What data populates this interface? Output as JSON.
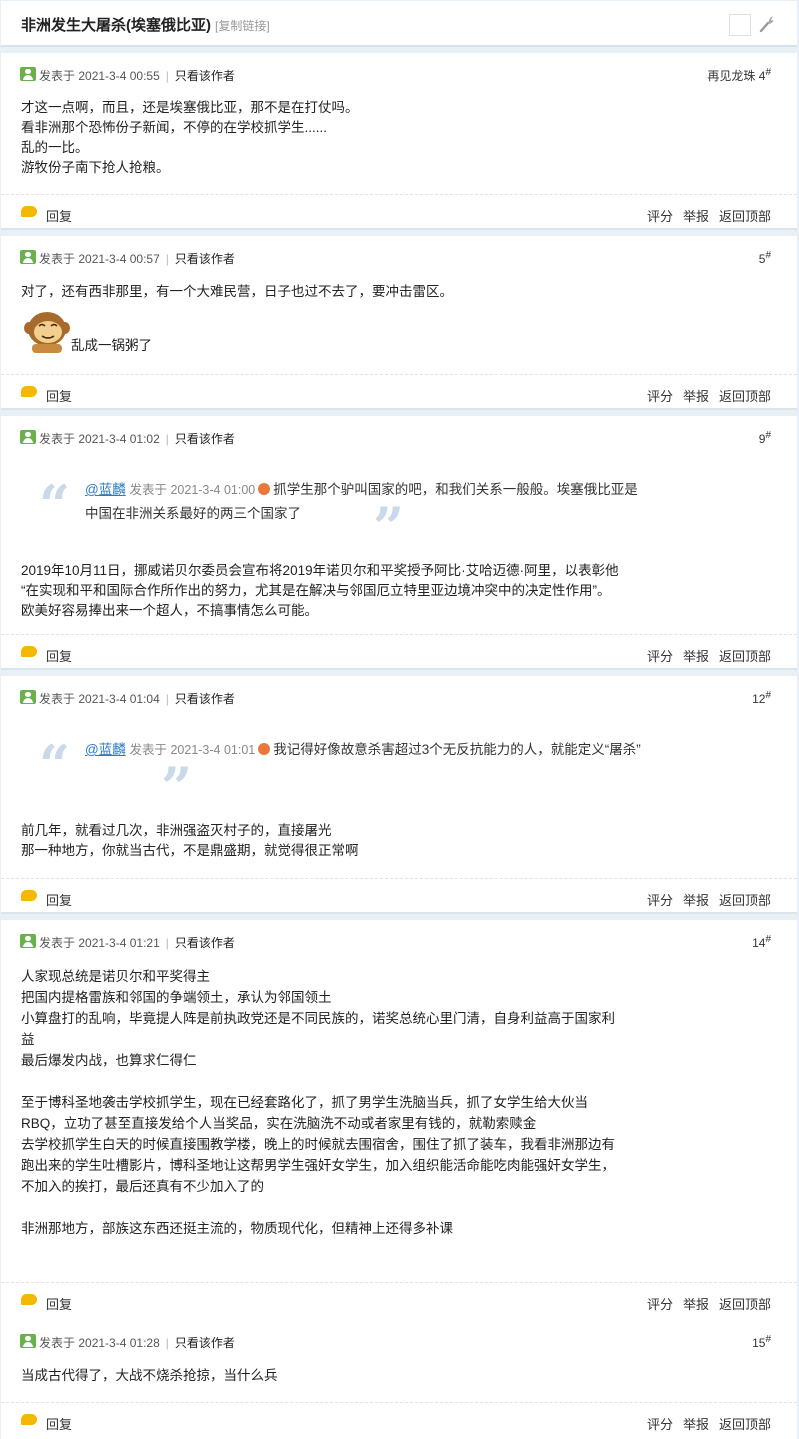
{
  "thread": {
    "title": "非洲发生大屠杀(埃塞俄比亚)",
    "copy_link": "[复制链接]"
  },
  "labels": {
    "posted_at": "发表于",
    "only_author": "只看该作者",
    "reply": "回复",
    "rate": "评分",
    "report": "举报",
    "back_top": "返回顶部",
    "floor_mark": "#"
  },
  "posts": [
    {
      "time": "2021-3-4 00:55",
      "floor_prefix": "再见龙珠",
      "floor": "4",
      "lines": [
        "才这一点啊，而且，还是埃塞俄比亚，那不是在打仗吗。",
        "看非洲那个恐怖份子新闻，不停的在学校抓学生......",
        "乱的一比。",
        "游牧份子南下抢人抢粮。"
      ]
    },
    {
      "time": "2021-3-4 00:57",
      "floor": "5",
      "lines": [
        "对了，还有西非那里，有一个大难民营，日子也过不去了，要冲击雷区。"
      ],
      "emoji_caption": "乱成一锅粥了"
    },
    {
      "time": "2021-3-4 01:02",
      "floor": "9",
      "quote": {
        "user": "@蓝麟",
        "meta": "发表于 2021-3-4 01:00",
        "text": "抓学生那个驴叫国家的吧，和我们关系一般般。埃塞俄比亚是中国在非洲关系最好的两三个国家了"
      },
      "lines": [
        "2019年10月11日，挪威诺贝尔委员会宣布将2019年诺贝尔和平奖授予阿比·艾哈迈德·阿里，以表彰他",
        "“在实现和平和国际合作所作出的努力，尤其是在解决与邻国厄立特里亚边境冲突中的决定性作用”。",
        "欧美好容易捧出来一个超人，不搞事情怎么可能。"
      ]
    },
    {
      "time": "2021-3-4 01:04",
      "floor": "12",
      "quote": {
        "user": "@蓝麟",
        "meta": "发表于 2021-3-4 01:01",
        "text": "我记得好像故意杀害超过3个无反抗能力的人，就能定义“屠杀”"
      },
      "lines": [
        "前几年，就看过几次，非洲强盗灭村子的，直接屠光",
        "那一种地方，你就当古代，不是鼎盛期，就觉得很正常啊"
      ]
    },
    {
      "time": "2021-3-4 01:21",
      "floor": "14",
      "lines": [
        "人家现总统是诺贝尔和平奖得主",
        "把国内提格雷族和邻国的争端领土，承认为邻国领土",
        "小算盘打的乱响，毕竟提人阵是前执政党还是不同民族的，诺奖总统心里门清，自身利益高于国家利",
        "益",
        "最后爆发内战，也算求仁得仁",
        "",
        "至于博科圣地袭击学校抓学生，现在已经套路化了，抓了男学生洗脑当兵，抓了女学生给大伙当",
        "RBQ，立功了甚至直接发给个人当奖品，实在洗脑洗不动或者家里有钱的，就勒索赎金",
        "去学校抓学生白天的时候直接围教学楼，晚上的时候就去围宿舍，围住了抓了装车，我看非洲那边有",
        "跑出来的学生吐槽影片，博科圣地让这帮男学生强奸女学生，加入组织能活命能吃肉能强奸女学生，",
        "不加入的挨打，最后还真有不少加入了的",
        "",
        "非洲那地方，部族这东西还挺主流的，物质现代化，但精神上还得多补课"
      ]
    },
    {
      "time": "2021-3-4 01:28",
      "floor": "15",
      "lines": [
        "当成古代得了，大战不烧杀抢掠，当什么兵"
      ]
    }
  ]
}
